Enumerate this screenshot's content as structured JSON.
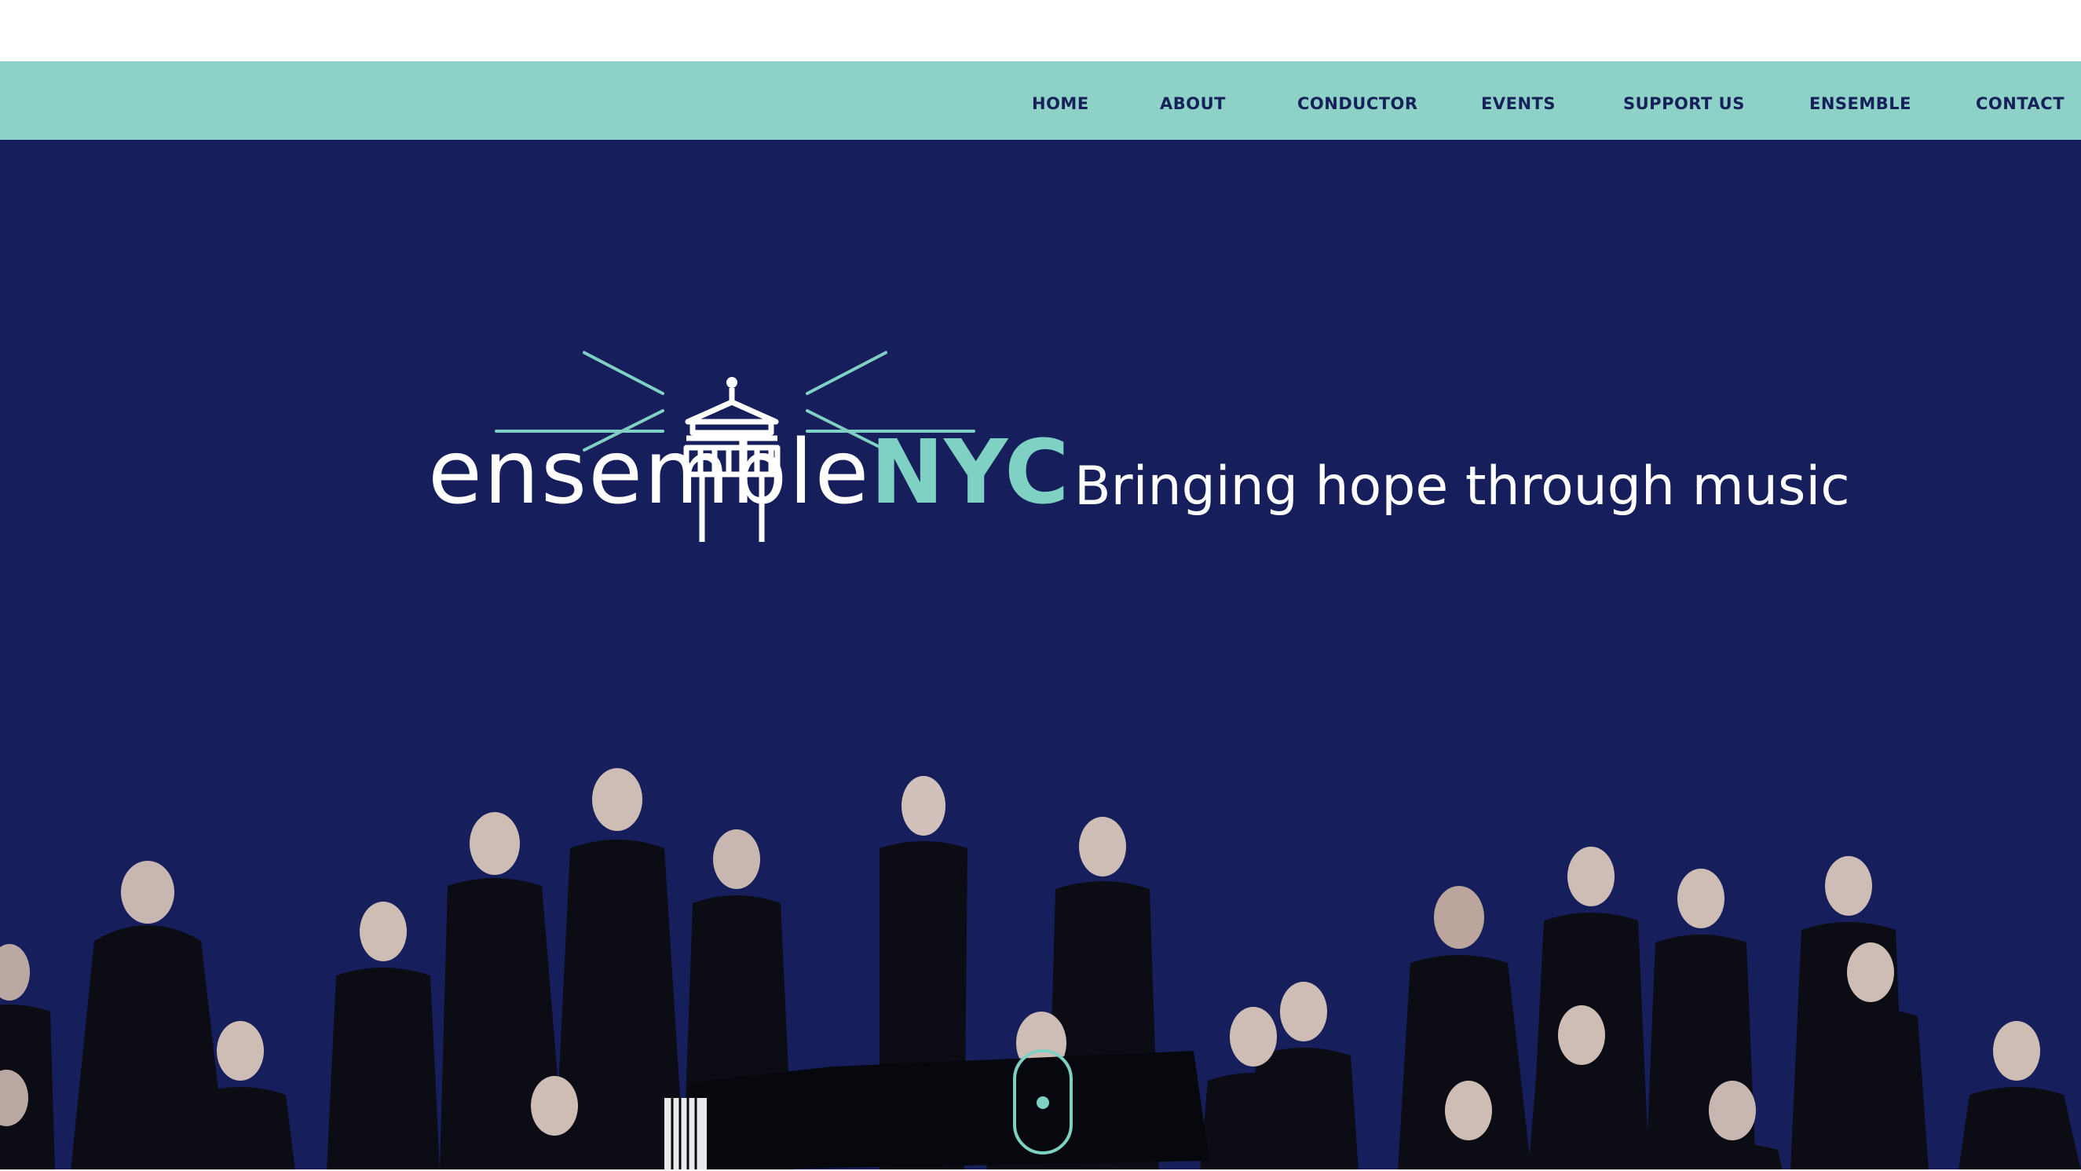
{
  "nav": {
    "items": [
      {
        "label": "HOME"
      },
      {
        "label": "ABOUT"
      },
      {
        "label": "CONDUCTOR"
      },
      {
        "label": "EVENTS"
      },
      {
        "label": "SUPPORT US"
      },
      {
        "label": "ENSEMBLE"
      },
      {
        "label": "CONTACT"
      }
    ]
  },
  "hero": {
    "logo_light": "ensemble",
    "logo_bold": "NYC",
    "tagline": "Bringing hope through music"
  },
  "colors": {
    "nav_bg": "#8dd1c7",
    "hero_bg": "#161f5c",
    "accent": "#7fd1c4",
    "nav_text": "#16215a"
  },
  "icons": {
    "logo": "lighthouse-icon",
    "scroll": "scroll-down-icon"
  }
}
